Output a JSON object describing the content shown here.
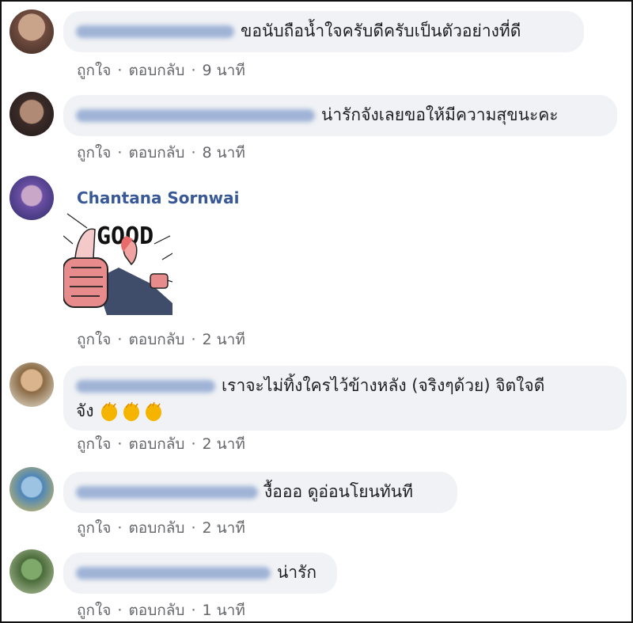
{
  "colors": {
    "bubble": "#f0f2f5",
    "author": "#385898",
    "meta": "#65676b"
  },
  "action_like": "ถูกใจ",
  "action_reply": "ตอบกลับ",
  "separator": "·",
  "comments": [
    {
      "text": "ขอนับถือน้ำใจครับดีครับเป็นตัวอย่างที่ดี",
      "time": "9 นาที"
    },
    {
      "text": "น่ารักจังเลยขอให้มีความสุขนะคะ",
      "time": "8 นาที"
    },
    {
      "author": "Chantana Sornwai",
      "sticker_text": "GOOD",
      "time": "2 นาที"
    },
    {
      "text_line1": "เราจะไม่ทิ้งใครไว้ข้างหลัง (จริงๆด้วย) จิตใจดี",
      "text_line2": "จัง",
      "emoji": "clapping-hands x3",
      "time": "2 นาที"
    },
    {
      "text": "งื้อออ ดูอ่อนโยนทันที",
      "time": "2 นาที"
    },
    {
      "text": "น่ารัก",
      "time": "1 นาที"
    }
  ]
}
